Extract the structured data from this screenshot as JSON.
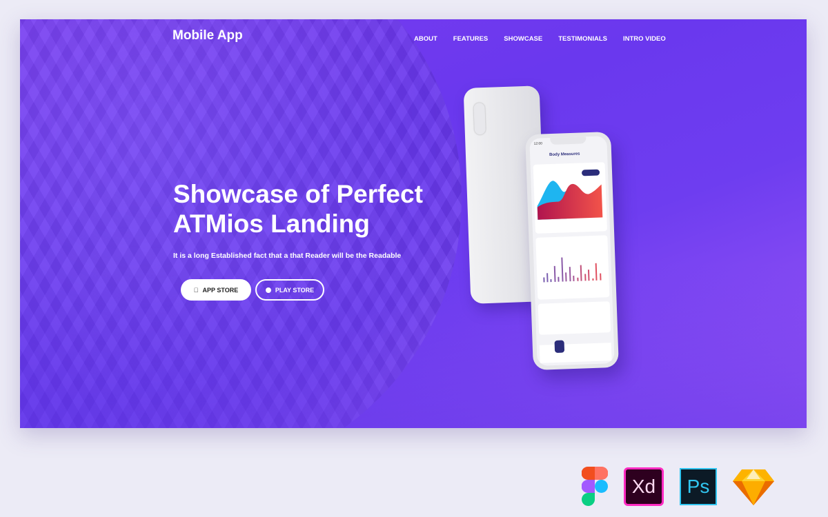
{
  "header": {
    "logo": "Mobile App",
    "nav": [
      "ABOUT",
      "FEATURES",
      "SHOWCASE",
      "TESTIMONIALS",
      "INTRO VIDEO"
    ]
  },
  "hero": {
    "title": "Showcase of Perfect ATMios Landing",
    "subtitle": "It is a long Established fact that a that Reader will be the Readable",
    "app_store": "APP STORE",
    "play_store": "PLAY STORE"
  },
  "phone": {
    "time": "12:00",
    "screen_title": "Body Measures"
  },
  "tools": [
    {
      "name": "figma-icon"
    },
    {
      "name": "xd-icon",
      "label": "Xd",
      "color": "#ff2bc2"
    },
    {
      "name": "ps-icon",
      "label": "Ps",
      "color": "#31c5f0"
    },
    {
      "name": "sketch-icon"
    }
  ],
  "colors": {
    "accent": "#6a38ee",
    "accent2": "#9c58f6"
  }
}
